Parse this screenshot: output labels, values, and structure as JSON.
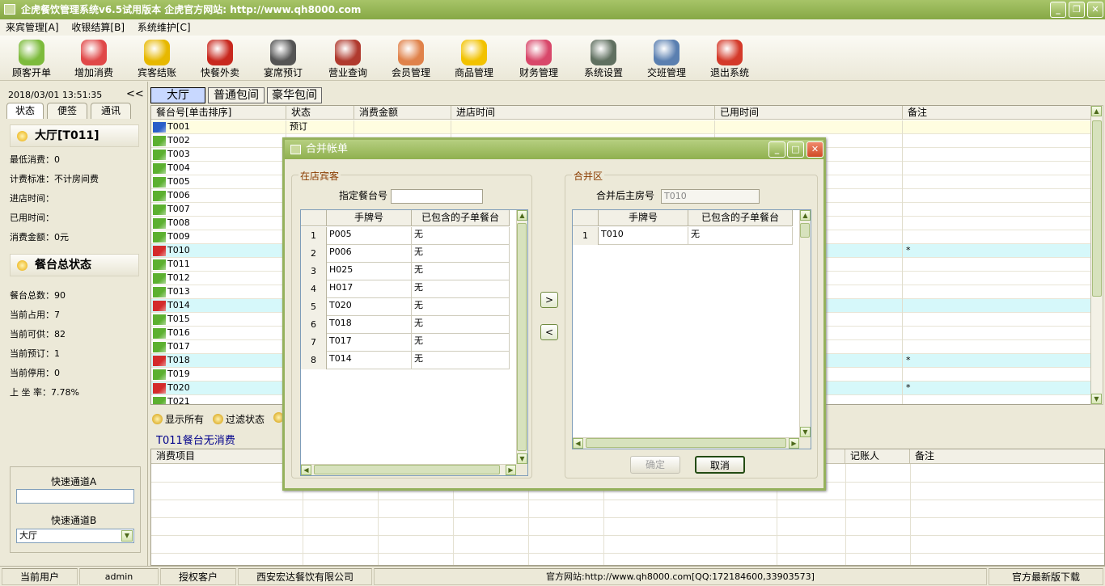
{
  "window": {
    "title": "企虎餐饮管理系统v6.5试用版本   企虎官方网站: http://www.qh8000.com"
  },
  "menu": [
    "来宾管理[A]",
    "收银结算[B]",
    "系统维护[C]"
  ],
  "toolbar": [
    {
      "label": "顾客开单",
      "icon": "customer-icon",
      "color": "#7dbb3c"
    },
    {
      "label": "增加消费",
      "icon": "add-consume-icon",
      "color": "#e04848"
    },
    {
      "label": "宾客结账",
      "icon": "checkout-icon",
      "color": "#e7b800"
    },
    {
      "label": "快餐外卖",
      "icon": "takeout-icon",
      "color": "#c8281e"
    },
    {
      "label": "宴席预订",
      "icon": "alarm-clock-icon",
      "color": "#555555"
    },
    {
      "label": "营业查询",
      "icon": "query-icon",
      "color": "#b03a2e"
    },
    {
      "label": "会员管理",
      "icon": "members-icon",
      "color": "#e0824a"
    },
    {
      "label": "商品管理",
      "icon": "star-icon",
      "color": "#f2c200"
    },
    {
      "label": "财务管理",
      "icon": "finance-icon",
      "color": "#d8476a"
    },
    {
      "label": "系统设置",
      "icon": "settings-icon",
      "color": "#607060"
    },
    {
      "label": "交班管理",
      "icon": "handshake-icon",
      "color": "#5a7fb0"
    },
    {
      "label": "退出系统",
      "icon": "power-icon",
      "color": "#d43a2a"
    }
  ],
  "left": {
    "datetime": "2018/03/01  13:51:35",
    "collapse": "<<",
    "tabs": [
      "状态",
      "便签",
      "通讯"
    ],
    "table_head": "大厅[T011]",
    "min_consume": "最低消费：0",
    "fee_standard": "计费标准：不计房间费",
    "enter_time": "进店时间：",
    "used_time": "已用时间：",
    "amount": "消费金额：0元",
    "status_head": "餐台总状态",
    "total": "餐台总数：90",
    "occupied": "当前占用：7",
    "available": "当前可供：82",
    "reserved": "当前预订：1",
    "suspended": "当前停用：0",
    "rate": "上 坐 率：7.78%",
    "quick_a": "快速通道A",
    "quick_b": "快速通道B",
    "quick_b_value": "大厅"
  },
  "room_tabs": [
    "大厅",
    "普通包间",
    "豪华包间"
  ],
  "main_headers": [
    "餐台号[单击排序]",
    "状态",
    "消费金额",
    "进店时间",
    "已用时间",
    "备注"
  ],
  "tables": [
    {
      "id": "T001",
      "flag": "#2a5ec8",
      "status": "预订",
      "note": "",
      "bg": "#fffde0"
    },
    {
      "id": "T002",
      "flag": "#5cb030",
      "status": "",
      "note": "",
      "bg": "#ffffff"
    },
    {
      "id": "T003",
      "flag": "#5cb030",
      "status": "",
      "note": "",
      "bg": "#ffffff"
    },
    {
      "id": "T004",
      "flag": "#5cb030",
      "status": "",
      "note": "",
      "bg": "#ffffff"
    },
    {
      "id": "T005",
      "flag": "#5cb030",
      "status": "",
      "note": "",
      "bg": "#ffffff"
    },
    {
      "id": "T006",
      "flag": "#5cb030",
      "status": "",
      "note": "",
      "bg": "#ffffff"
    },
    {
      "id": "T007",
      "flag": "#5cb030",
      "status": "",
      "note": "",
      "bg": "#ffffff"
    },
    {
      "id": "T008",
      "flag": "#5cb030",
      "status": "",
      "note": "",
      "bg": "#ffffff"
    },
    {
      "id": "T009",
      "flag": "#5cb030",
      "status": "",
      "note": "",
      "bg": "#ffffff"
    },
    {
      "id": "T010",
      "flag": "#d42b2b",
      "status": "",
      "note": "*",
      "bg": "#d6f8fa"
    },
    {
      "id": "T011",
      "flag": "#5cb030",
      "status": "",
      "note": "",
      "bg": "#ffffff"
    },
    {
      "id": "T012",
      "flag": "#5cb030",
      "status": "",
      "note": "",
      "bg": "#ffffff"
    },
    {
      "id": "T013",
      "flag": "#5cb030",
      "status": "",
      "note": "",
      "bg": "#ffffff"
    },
    {
      "id": "T014",
      "flag": "#d42b2b",
      "status": "",
      "note": "",
      "bg": "#d6f8fa"
    },
    {
      "id": "T015",
      "flag": "#5cb030",
      "status": "",
      "note": "",
      "bg": "#ffffff"
    },
    {
      "id": "T016",
      "flag": "#5cb030",
      "status": "",
      "note": "",
      "bg": "#ffffff"
    },
    {
      "id": "T017",
      "flag": "#5cb030",
      "status": "",
      "note": "",
      "bg": "#ffffff"
    },
    {
      "id": "T018",
      "flag": "#d42b2b",
      "status": "",
      "note": "*",
      "bg": "#d6f8fa"
    },
    {
      "id": "T019",
      "flag": "#5cb030",
      "status": "",
      "note": "",
      "bg": "#ffffff"
    },
    {
      "id": "T020",
      "flag": "#d42b2b",
      "status": "",
      "note": "*",
      "bg": "#d6f8fa"
    },
    {
      "id": "T021",
      "flag": "#5cb030",
      "status": "",
      "note": "",
      "bg": "#ffffff"
    }
  ],
  "filter": {
    "show_all": "显示所有",
    "filter_state": "过滤状态"
  },
  "no_consume": "T011餐台无消费",
  "lower_headers": [
    "消费项目",
    "记账人",
    "备注"
  ],
  "dialog": {
    "title": "合并帐单",
    "left_group": "在店宾客",
    "table_label": "指定餐台号",
    "left_cols": [
      "手牌号",
      "已包含的子单餐台"
    ],
    "left_rows": [
      {
        "n": "1",
        "id": "P005",
        "sub": "无"
      },
      {
        "n": "2",
        "id": "P006",
        "sub": "无"
      },
      {
        "n": "3",
        "id": "H025",
        "sub": "无"
      },
      {
        "n": "4",
        "id": "H017",
        "sub": "无"
      },
      {
        "n": "5",
        "id": "T020",
        "sub": "无"
      },
      {
        "n": "6",
        "id": "T018",
        "sub": "无"
      },
      {
        "n": "7",
        "id": "T017",
        "sub": "无"
      },
      {
        "n": "8",
        "id": "T014",
        "sub": "无"
      }
    ],
    "right_group": "合并区",
    "main_room_label": "合并后主房号",
    "main_room_value": "T010",
    "right_cols": [
      "手牌号",
      "已包含的子单餐台"
    ],
    "right_rows": [
      {
        "n": "1",
        "id": "T010",
        "sub": "无"
      }
    ],
    "move_right": ">",
    "move_left": "<",
    "ok": "确定",
    "cancel": "取消"
  },
  "status": {
    "user_label": "当前用户",
    "user": "admin",
    "client_label": "授权客户",
    "client": "西安宏达餐饮有限公司",
    "site": "官方网站:http://www.qh8000.com[QQ:172184600,33903573]",
    "download": "官方最新版下载"
  }
}
